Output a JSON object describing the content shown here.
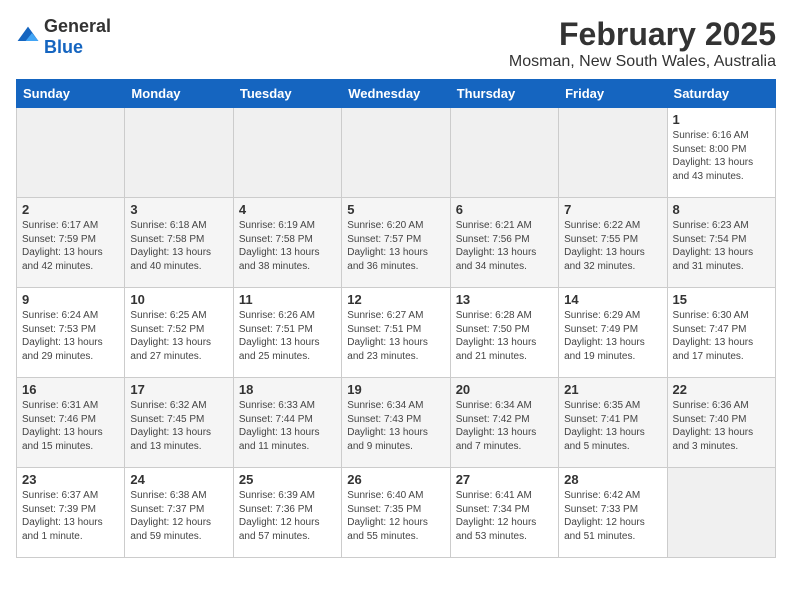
{
  "header": {
    "logo_general": "General",
    "logo_blue": "Blue",
    "title": "February 2025",
    "subtitle": "Mosman, New South Wales, Australia"
  },
  "days_of_week": [
    "Sunday",
    "Monday",
    "Tuesday",
    "Wednesday",
    "Thursday",
    "Friday",
    "Saturday"
  ],
  "weeks": [
    [
      {
        "day": "",
        "info": ""
      },
      {
        "day": "",
        "info": ""
      },
      {
        "day": "",
        "info": ""
      },
      {
        "day": "",
        "info": ""
      },
      {
        "day": "",
        "info": ""
      },
      {
        "day": "",
        "info": ""
      },
      {
        "day": "1",
        "info": "Sunrise: 6:16 AM\nSunset: 8:00 PM\nDaylight: 13 hours\nand 43 minutes."
      }
    ],
    [
      {
        "day": "2",
        "info": "Sunrise: 6:17 AM\nSunset: 7:59 PM\nDaylight: 13 hours\nand 42 minutes."
      },
      {
        "day": "3",
        "info": "Sunrise: 6:18 AM\nSunset: 7:58 PM\nDaylight: 13 hours\nand 40 minutes."
      },
      {
        "day": "4",
        "info": "Sunrise: 6:19 AM\nSunset: 7:58 PM\nDaylight: 13 hours\nand 38 minutes."
      },
      {
        "day": "5",
        "info": "Sunrise: 6:20 AM\nSunset: 7:57 PM\nDaylight: 13 hours\nand 36 minutes."
      },
      {
        "day": "6",
        "info": "Sunrise: 6:21 AM\nSunset: 7:56 PM\nDaylight: 13 hours\nand 34 minutes."
      },
      {
        "day": "7",
        "info": "Sunrise: 6:22 AM\nSunset: 7:55 PM\nDaylight: 13 hours\nand 32 minutes."
      },
      {
        "day": "8",
        "info": "Sunrise: 6:23 AM\nSunset: 7:54 PM\nDaylight: 13 hours\nand 31 minutes."
      }
    ],
    [
      {
        "day": "9",
        "info": "Sunrise: 6:24 AM\nSunset: 7:53 PM\nDaylight: 13 hours\nand 29 minutes."
      },
      {
        "day": "10",
        "info": "Sunrise: 6:25 AM\nSunset: 7:52 PM\nDaylight: 13 hours\nand 27 minutes."
      },
      {
        "day": "11",
        "info": "Sunrise: 6:26 AM\nSunset: 7:51 PM\nDaylight: 13 hours\nand 25 minutes."
      },
      {
        "day": "12",
        "info": "Sunrise: 6:27 AM\nSunset: 7:51 PM\nDaylight: 13 hours\nand 23 minutes."
      },
      {
        "day": "13",
        "info": "Sunrise: 6:28 AM\nSunset: 7:50 PM\nDaylight: 13 hours\nand 21 minutes."
      },
      {
        "day": "14",
        "info": "Sunrise: 6:29 AM\nSunset: 7:49 PM\nDaylight: 13 hours\nand 19 minutes."
      },
      {
        "day": "15",
        "info": "Sunrise: 6:30 AM\nSunset: 7:47 PM\nDaylight: 13 hours\nand 17 minutes."
      }
    ],
    [
      {
        "day": "16",
        "info": "Sunrise: 6:31 AM\nSunset: 7:46 PM\nDaylight: 13 hours\nand 15 minutes."
      },
      {
        "day": "17",
        "info": "Sunrise: 6:32 AM\nSunset: 7:45 PM\nDaylight: 13 hours\nand 13 minutes."
      },
      {
        "day": "18",
        "info": "Sunrise: 6:33 AM\nSunset: 7:44 PM\nDaylight: 13 hours\nand 11 minutes."
      },
      {
        "day": "19",
        "info": "Sunrise: 6:34 AM\nSunset: 7:43 PM\nDaylight: 13 hours\nand 9 minutes."
      },
      {
        "day": "20",
        "info": "Sunrise: 6:34 AM\nSunset: 7:42 PM\nDaylight: 13 hours\nand 7 minutes."
      },
      {
        "day": "21",
        "info": "Sunrise: 6:35 AM\nSunset: 7:41 PM\nDaylight: 13 hours\nand 5 minutes."
      },
      {
        "day": "22",
        "info": "Sunrise: 6:36 AM\nSunset: 7:40 PM\nDaylight: 13 hours\nand 3 minutes."
      }
    ],
    [
      {
        "day": "23",
        "info": "Sunrise: 6:37 AM\nSunset: 7:39 PM\nDaylight: 13 hours\nand 1 minute."
      },
      {
        "day": "24",
        "info": "Sunrise: 6:38 AM\nSunset: 7:37 PM\nDaylight: 12 hours\nand 59 minutes."
      },
      {
        "day": "25",
        "info": "Sunrise: 6:39 AM\nSunset: 7:36 PM\nDaylight: 12 hours\nand 57 minutes."
      },
      {
        "day": "26",
        "info": "Sunrise: 6:40 AM\nSunset: 7:35 PM\nDaylight: 12 hours\nand 55 minutes."
      },
      {
        "day": "27",
        "info": "Sunrise: 6:41 AM\nSunset: 7:34 PM\nDaylight: 12 hours\nand 53 minutes."
      },
      {
        "day": "28",
        "info": "Sunrise: 6:42 AM\nSunset: 7:33 PM\nDaylight: 12 hours\nand 51 minutes."
      },
      {
        "day": "",
        "info": ""
      }
    ]
  ]
}
